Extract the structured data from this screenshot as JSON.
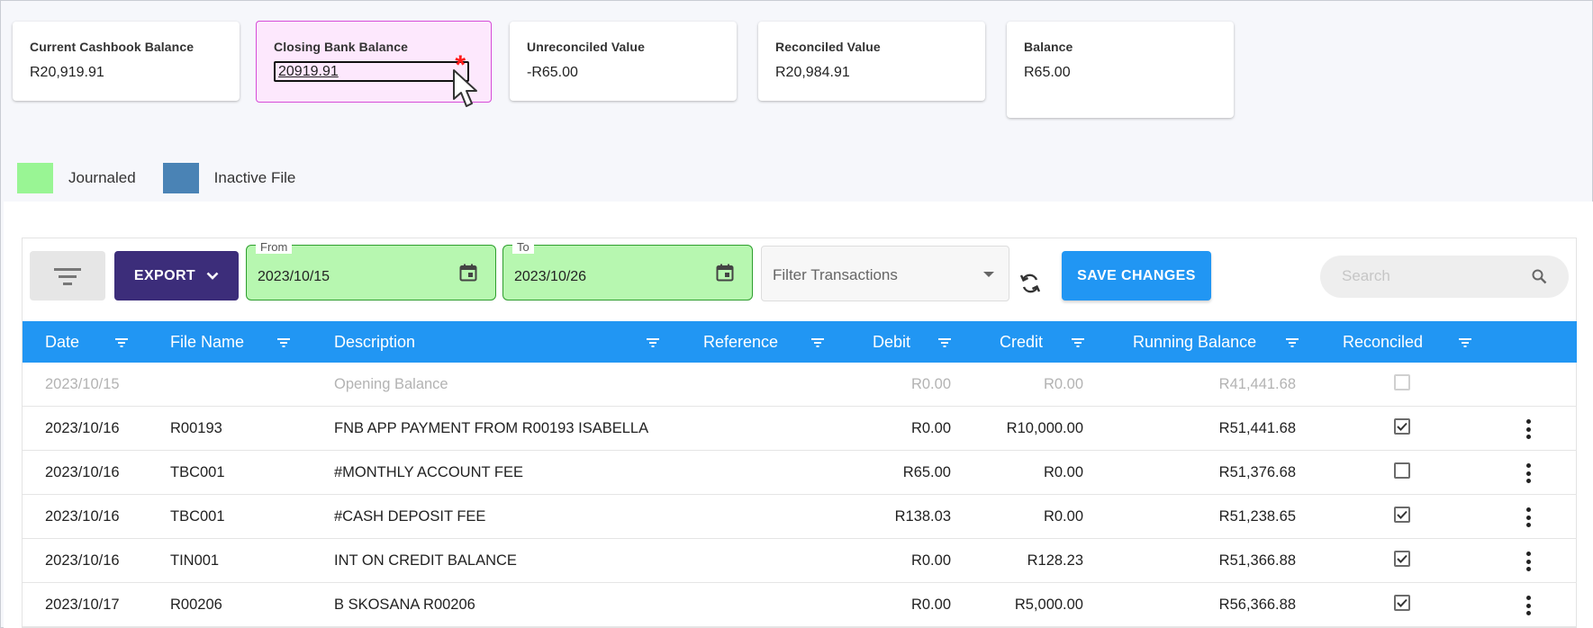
{
  "summary": {
    "cashbook": {
      "label": "Current Cashbook Balance",
      "value": "R20,919.91"
    },
    "bank": {
      "label": "Closing Bank Balance",
      "value": "20919.91",
      "required_mark": "*"
    },
    "unreconciled": {
      "label": "Unreconciled Value",
      "value": "-R65.00"
    },
    "reconciled": {
      "label": "Reconciled Value",
      "value": "R20,984.91"
    },
    "balance": {
      "label": "Balance",
      "value": "R65.00"
    }
  },
  "legend": [
    {
      "label": "Journaled",
      "color": "#99f594"
    },
    {
      "label": "Inactive File",
      "color": "#4a83b5"
    }
  ],
  "toolbar": {
    "export_label": "EXPORT",
    "from_label": "From",
    "from_value": "2023/10/15",
    "to_label": "To",
    "to_value": "2023/10/26",
    "filter_placeholder": "Filter Transactions",
    "save_label": "SAVE CHANGES",
    "search_placeholder": "Search"
  },
  "table": {
    "columns": [
      "Date",
      "File Name",
      "Description",
      "Reference",
      "Debit",
      "Credit",
      "Running Balance",
      "Reconciled"
    ],
    "rows": [
      {
        "date": "2023/10/15",
        "file": "",
        "desc": "Opening Balance",
        "ref": "",
        "debit": "R0.00",
        "credit": "R0.00",
        "balance": "R41,441.68",
        "reconciled": false,
        "muted": true
      },
      {
        "date": "2023/10/16",
        "file": "R00193",
        "desc": "FNB APP PAYMENT FROM R00193 ISABELLA",
        "ref": "",
        "debit": "R0.00",
        "credit": "R10,000.00",
        "balance": "R51,441.68",
        "reconciled": true,
        "muted": false
      },
      {
        "date": "2023/10/16",
        "file": "TBC001",
        "desc": "#MONTHLY ACCOUNT FEE",
        "ref": "",
        "debit": "R65.00",
        "credit": "R0.00",
        "balance": "R51,376.68",
        "reconciled": false,
        "muted": false
      },
      {
        "date": "2023/10/16",
        "file": "TBC001",
        "desc": "#CASH DEPOSIT FEE",
        "ref": "",
        "debit": "R138.03",
        "credit": "R0.00",
        "balance": "R51,238.65",
        "reconciled": true,
        "muted": false
      },
      {
        "date": "2023/10/16",
        "file": "TIN001",
        "desc": "INT ON CREDIT BALANCE",
        "ref": "",
        "debit": "R0.00",
        "credit": "R128.23",
        "balance": "R51,366.88",
        "reconciled": true,
        "muted": false
      },
      {
        "date": "2023/10/17",
        "file": "R00206",
        "desc": "B SKOSANA R00206",
        "ref": "",
        "debit": "R0.00",
        "credit": "R5,000.00",
        "balance": "R56,366.88",
        "reconciled": true,
        "muted": false
      }
    ]
  }
}
